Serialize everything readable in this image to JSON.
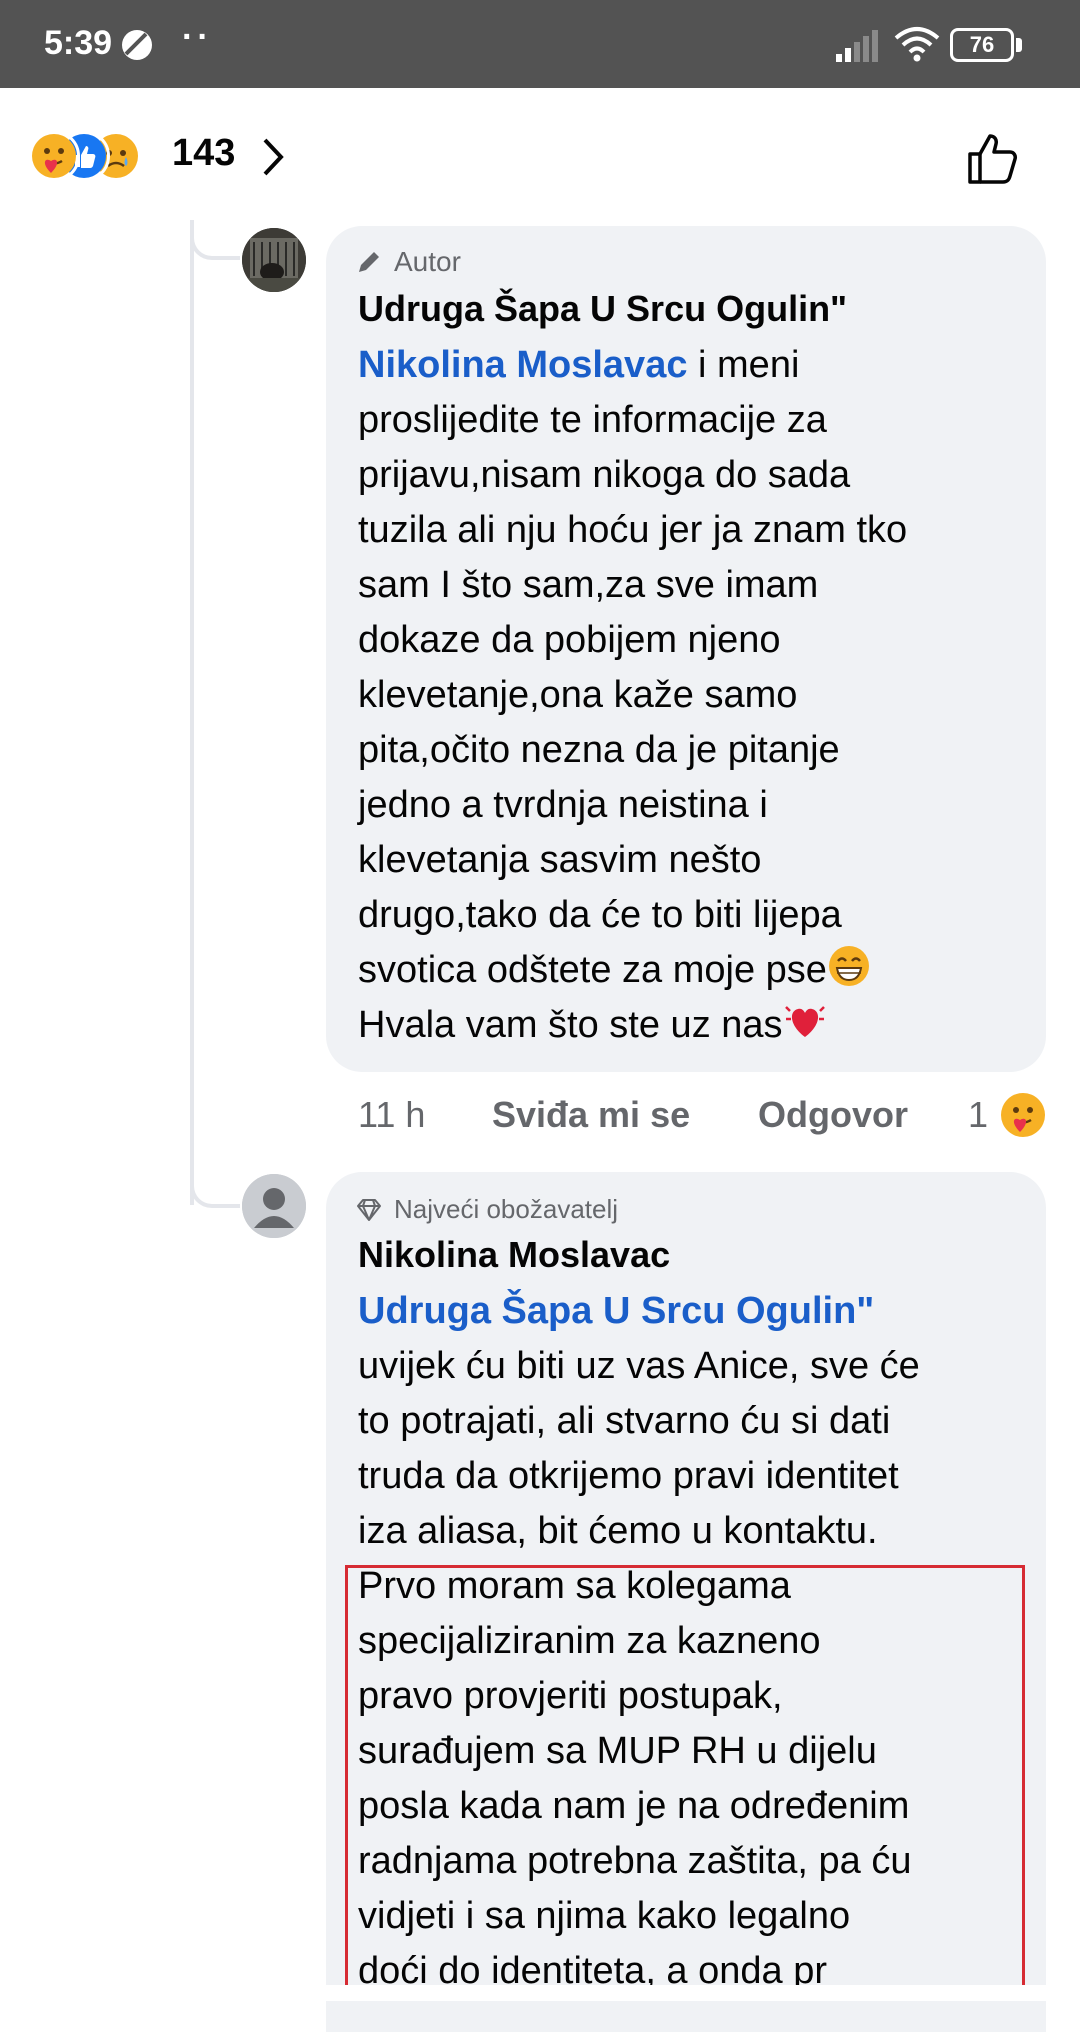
{
  "status_bar": {
    "time": "5:39",
    "dots": "··",
    "battery": "76"
  },
  "reactions": {
    "count": "143",
    "icons": [
      "care-emoji",
      "like-emoji",
      "sad-emoji"
    ]
  },
  "comments": [
    {
      "badge": "Autor",
      "badge_icon": "pencil-icon",
      "author": "Udruga Šapa U Srcu Ogulin\"",
      "mention": "Nikolina Moslavac",
      "lines": [
        " i meni",
        "proslijedite te informacije za",
        "prijavu,nisam nikoga do sada",
        "tuzila ali nju hoću jer ja znam tko",
        "sam I što sam,za sve imam",
        "dokaze da pobijem njeno",
        "klevetanje,ona kaže samo",
        "pita,očito nezna da je pitanje",
        "jedno a tvrdnja neistina i",
        "klevetanja sasvim nešto",
        "drugo,tako da će to biti lijepa",
        "svotica odštete za moje pse",
        "Hvala vam što ste uz nas"
      ],
      "time": "11 h",
      "like_label": "Sviđa mi se",
      "reply_label": "Odgovor",
      "reaction_count": "1"
    },
    {
      "badge": "Najveći obožavatelj",
      "badge_icon": "diamond-icon",
      "author": "Nikolina Moslavac",
      "mention": "Udruga Šapa U Srcu Ogulin\"",
      "lines": [
        "uvijek ću biti uz vas Anice, sve će",
        "to potrajati, ali stvarno ću si dati",
        "truda da otkrijemo pravi identitet",
        "iza aliasa, bit ćemo u kontaktu.",
        "Prvo moram sa kolegama",
        "specijaliziranim za kazneno",
        "pravo provjeriti postupak,",
        "surađujem sa MUP RH u dijelu",
        "posla kada nam je na određenim",
        "radnjama potrebna zaštita, pa ću",
        "vidjeti i sa njima kako legalno",
        "doći do identiteta, a onda pr"
      ]
    }
  ],
  "colors": {
    "mention": "#1a5ec9",
    "bubble": "#f0f2f5",
    "highlight": "#d62b33",
    "status_bar": "#535353"
  }
}
